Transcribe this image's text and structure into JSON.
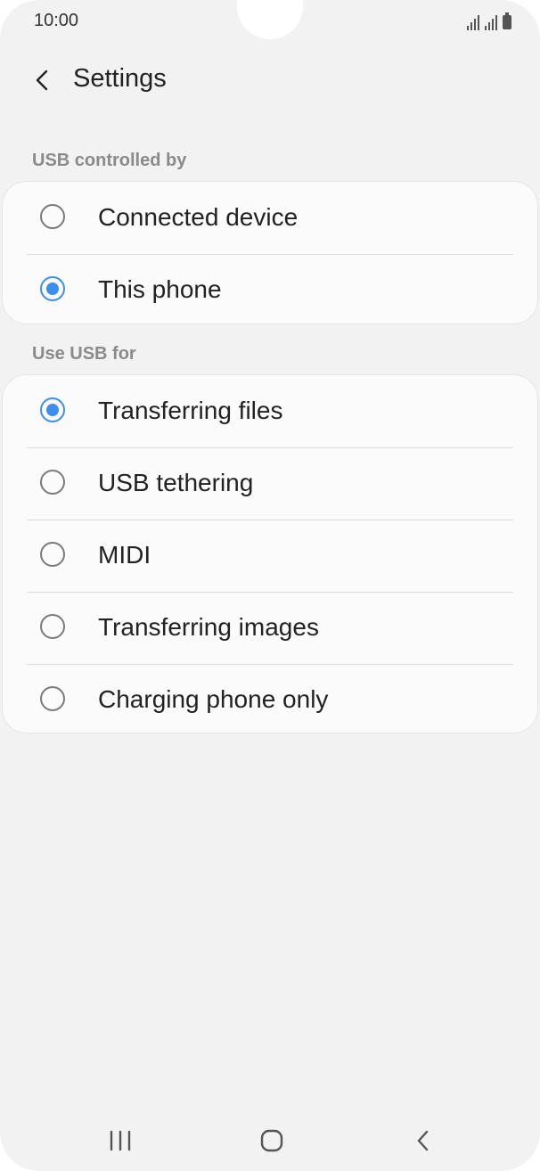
{
  "status_bar": {
    "time": "10:00"
  },
  "header": {
    "back_icon": "chevron-left-icon",
    "title": "Settings"
  },
  "usb_controlled_by": {
    "label": "USB controlled by",
    "options": [
      {
        "label": "Connected device",
        "selected": false
      },
      {
        "label": "This phone",
        "selected": true
      }
    ]
  },
  "use_usb_for": {
    "label": "Use USB for",
    "options": [
      {
        "label": "Transferring files",
        "selected": true
      },
      {
        "label": "USB tethering",
        "selected": false
      },
      {
        "label": "MIDI",
        "selected": false
      },
      {
        "label": "Transferring images",
        "selected": false
      },
      {
        "label": "Charging phone only",
        "selected": false
      }
    ]
  },
  "nav_bar": {
    "recents_icon": "recents-icon",
    "home_icon": "home-icon",
    "back_icon": "back-icon"
  },
  "colors": {
    "accent": "#3e8ef0",
    "background": "#f2f2f2",
    "card": "#fbfbfb"
  }
}
